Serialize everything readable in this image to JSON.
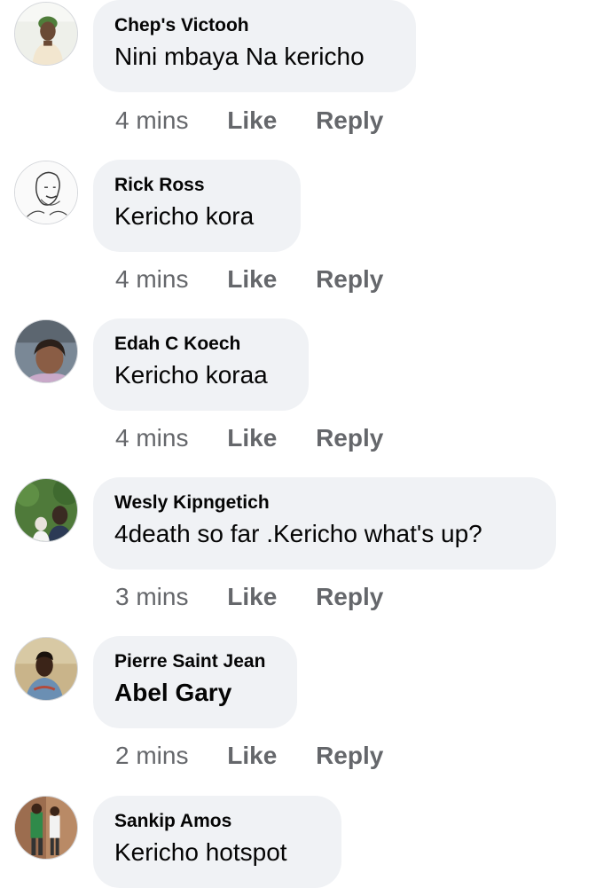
{
  "comments": [
    {
      "author": "Chep's Victooh",
      "text": "Nini mbaya Na kericho",
      "time": "4 mins",
      "like_label": "Like",
      "reply_label": "Reply",
      "avatar_icon": "profile-photo-person-green-cap"
    },
    {
      "author": "Rick Ross",
      "text": "Kericho kora",
      "time": "4 mins",
      "like_label": "Like",
      "reply_label": "Reply",
      "avatar_icon": "profile-photo-sketch-face"
    },
    {
      "author": "Edah C Koech",
      "text": "Kericho koraa",
      "time": "4 mins",
      "like_label": "Like",
      "reply_label": "Reply",
      "avatar_icon": "profile-photo-woman-selfie"
    },
    {
      "author": "Wesly Kipngetich",
      "text": "4death so far .Kericho  what's up?",
      "time": "3 mins",
      "like_label": "Like",
      "reply_label": "Reply",
      "avatar_icon": "profile-photo-man-with-child"
    },
    {
      "author": "Pierre Saint Jean",
      "text": "Abel Gary",
      "time": "2 mins",
      "like_label": "Like",
      "reply_label": "Reply",
      "avatar_icon": "profile-photo-man-outdoors"
    },
    {
      "author": "Sankip Amos",
      "text": "Kericho  hotspot",
      "time": "",
      "like_label": "",
      "reply_label": "",
      "avatar_icon": "profile-photo-two-people-standing"
    }
  ],
  "colors": {
    "bubble_background": "#f0f2f5",
    "name_text": "#050505",
    "meta_text": "#65676b"
  }
}
